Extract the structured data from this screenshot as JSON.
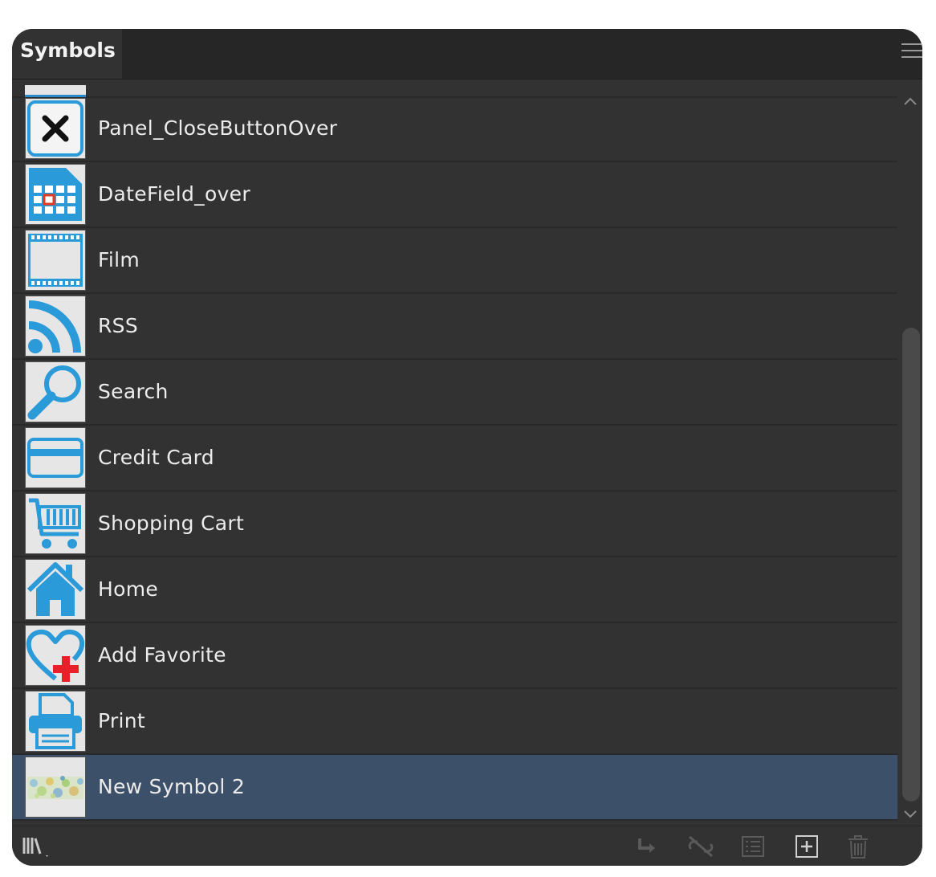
{
  "panel": {
    "tab_title": "Symbols"
  },
  "symbols": [
    {
      "label": "Panel_CloseButtonOver",
      "icon": "close-x-icon"
    },
    {
      "label": "DateField_over",
      "icon": "calendar-icon"
    },
    {
      "label": "Film",
      "icon": "film-icon"
    },
    {
      "label": "RSS",
      "icon": "rss-icon"
    },
    {
      "label": "Search",
      "icon": "magnifier-icon"
    },
    {
      "label": "Credit Card",
      "icon": "credit-card-icon"
    },
    {
      "label": "Shopping Cart",
      "icon": "shopping-cart-icon"
    },
    {
      "label": "Home",
      "icon": "home-icon"
    },
    {
      "label": "Add Favorite",
      "icon": "heart-plus-icon"
    },
    {
      "label": "Print",
      "icon": "printer-icon"
    },
    {
      "label": "New Symbol 2",
      "icon": "pattern-swatch-icon",
      "selected": true
    }
  ],
  "footer_icons": [
    "symbol-libraries-icon",
    "place-symbol-instance-icon",
    "break-link-icon",
    "symbol-options-icon",
    "new-symbol-icon",
    "delete-symbol-icon"
  ],
  "colors": {
    "panel_bg": "#323232",
    "titlebar_bg": "#262626",
    "selected_row": "#3c5069",
    "icon_blue": "#2b9ad8",
    "text": "#ececec"
  }
}
